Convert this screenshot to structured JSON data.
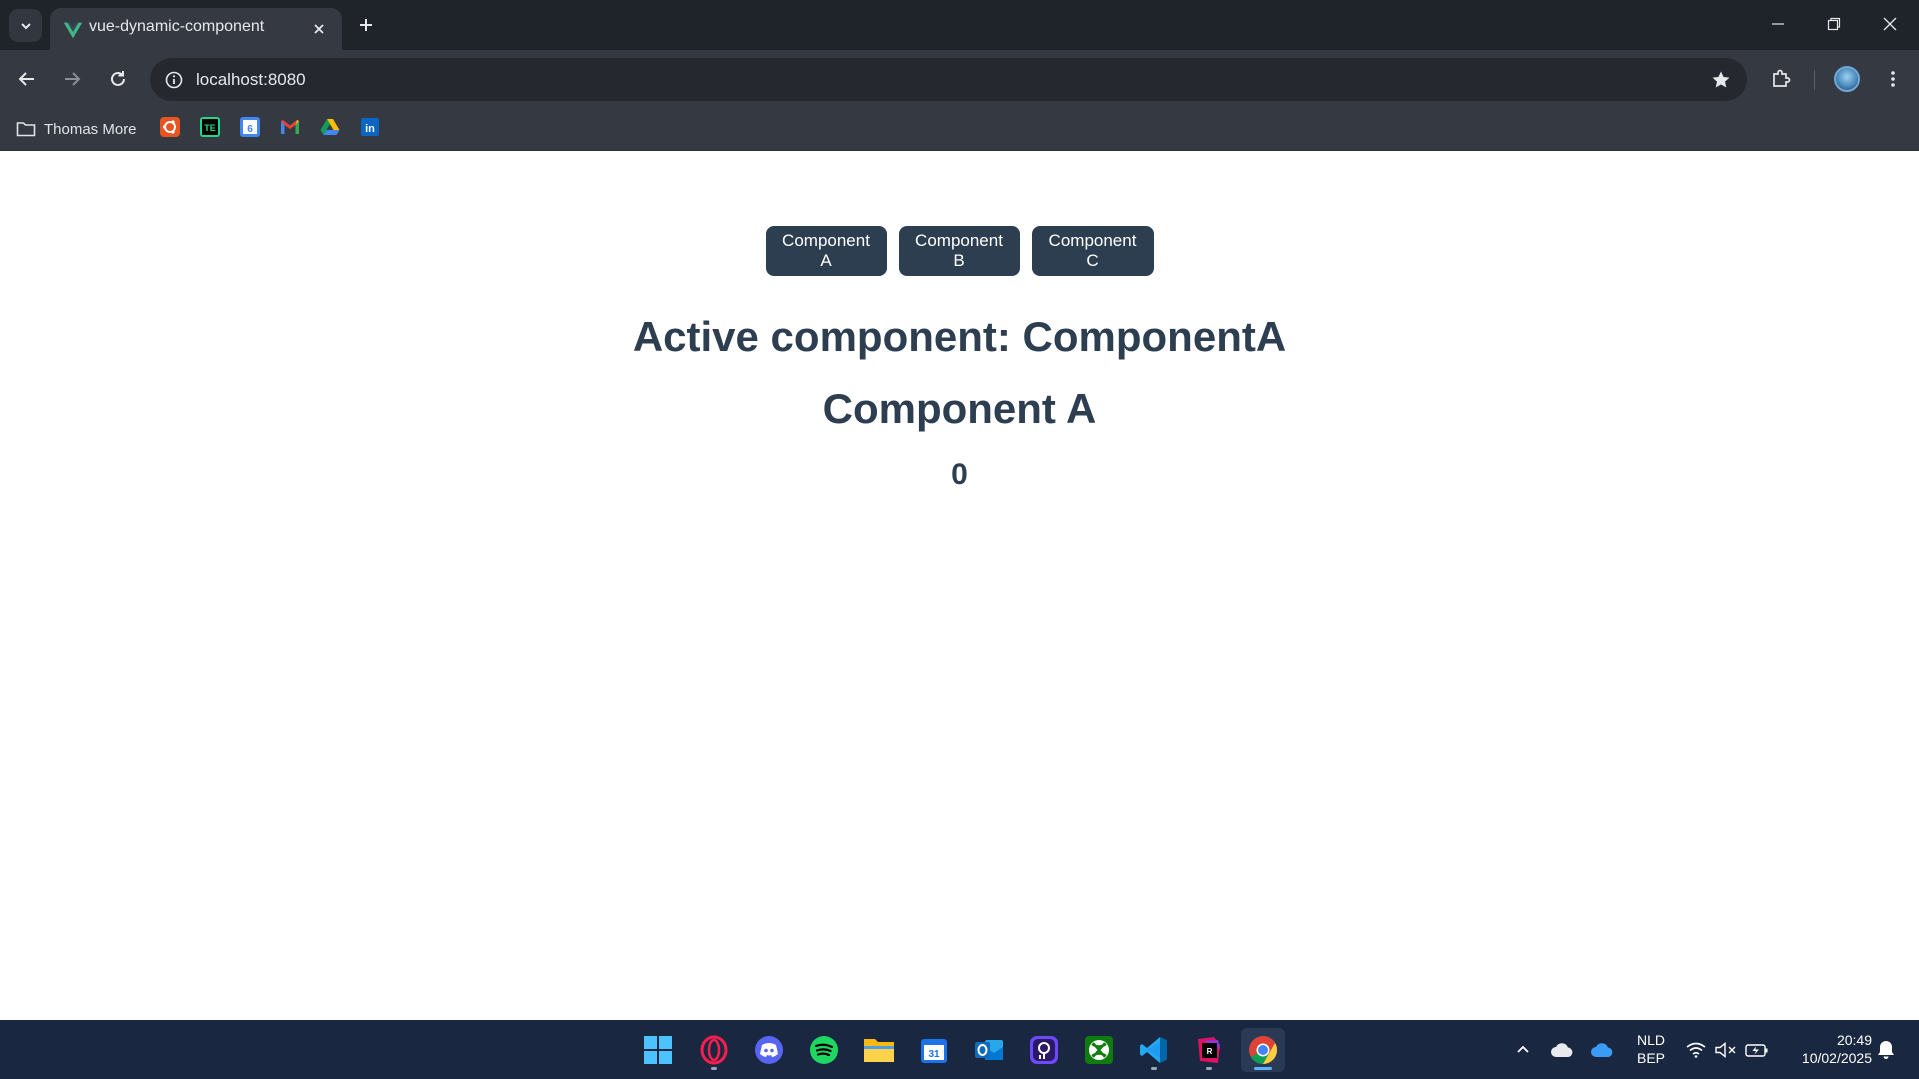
{
  "browser": {
    "tab": {
      "title": "vue-dynamic-component",
      "favicon": "vue-logo-icon"
    },
    "omnibox": {
      "url": "localhost:8080"
    },
    "bookmarks": {
      "folder_label": "Thomas More",
      "items": [
        "ubuntu-icon",
        "te-icon",
        "google-calendar-icon",
        "gmail-icon",
        "google-drive-icon",
        "linkedin-icon"
      ]
    }
  },
  "app": {
    "buttons": [
      {
        "label": "Component A"
      },
      {
        "label": "Component B"
      },
      {
        "label": "Component C"
      }
    ],
    "active_component_text": "Active component: ComponentA",
    "component_heading": "Component A",
    "counter_value": "0"
  },
  "taskbar": {
    "apps": [
      "windows-start-icon",
      "opera-gx-icon",
      "discord-icon",
      "spotify-icon",
      "file-explorer-icon",
      "calendar-icon",
      "outlook-icon",
      "proton-pass-icon",
      "xbox-icon",
      "vscode-icon",
      "rider-icon",
      "chrome-icon"
    ],
    "language": "NLD",
    "layout": "BEP",
    "time": "20:49",
    "date": "10/02/2025"
  },
  "colors": {
    "accent": "#2c3e50",
    "vue_green": "#41b883",
    "taskbar_bg": "#1a2740",
    "chrome_dark": "#1f232a"
  }
}
